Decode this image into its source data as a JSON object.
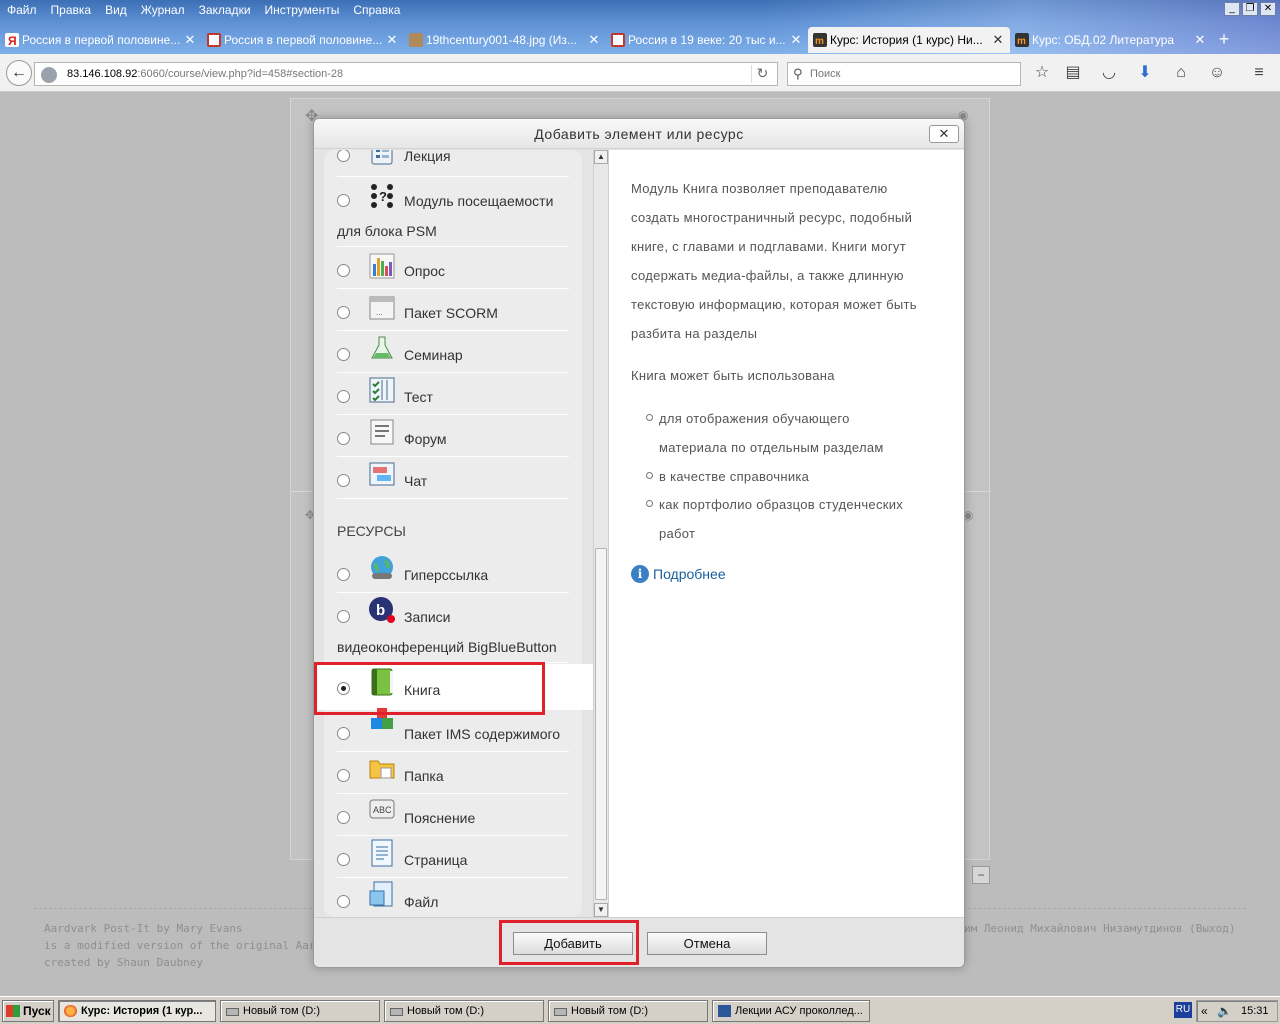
{
  "browser": {
    "menu": [
      "Файл",
      "Правка",
      "Вид",
      "Журнал",
      "Закладки",
      "Инструменты",
      "Справка"
    ],
    "tabs": [
      {
        "title": "Россия в первой половине...",
        "icon": "yandex-icon",
        "active": false
      },
      {
        "title": "Россия в первой половине...",
        "icon": "image-icon",
        "active": false
      },
      {
        "title": "19thcentury001-48.jpg (Из...",
        "icon": "jpg-icon",
        "active": false
      },
      {
        "title": "Россия в 19 веке: 20 тыс и...",
        "icon": "image-icon",
        "active": false
      },
      {
        "title": "Курс: История (1 курс) Ни...",
        "icon": "moodle-icon",
        "active": true
      },
      {
        "title": "Курс: ОБД.02 Литература",
        "icon": "moodle-icon",
        "active": false
      }
    ],
    "url_host": "83.146.108.92",
    "url_rest": ":6060/course/view.php?id=458#section-28",
    "search_placeholder": "Поиск"
  },
  "page": {
    "footer_left": [
      "Aardvark Post-It by Mary Evans",
      "is a modified version of the original Aardvark the",
      "created by Shaun Daubney"
    ],
    "footer_right": "им Леонид Михайлович Низамутдинов (Выход)"
  },
  "modal": {
    "title": "Добавить элемент или ресурс",
    "close_label": "✕",
    "activities": [
      {
        "label": "Лекция",
        "icon": "lesson-icon"
      },
      {
        "label": "Модуль посещаемости",
        "label2": "для блока PSM",
        "icon": "attendance-icon"
      },
      {
        "label": "Опрос",
        "icon": "choice-icon"
      },
      {
        "label": "Пакет SCORM",
        "icon": "scorm-icon"
      },
      {
        "label": "Семинар",
        "icon": "workshop-icon"
      },
      {
        "label": "Тест",
        "icon": "quiz-icon"
      },
      {
        "label": "Форум",
        "icon": "forum-icon"
      },
      {
        "label": "Чат",
        "icon": "chat-icon"
      }
    ],
    "resources_heading": "РЕСУРСЫ",
    "resources": [
      {
        "label": "Гиперссылка",
        "icon": "url-icon"
      },
      {
        "label": "Записи",
        "label2": "видеоконференций BigBlueButton",
        "icon": "bigbluebutton-icon"
      },
      {
        "label": "Книга",
        "icon": "book-icon",
        "selected": true
      },
      {
        "label": "Пакет IMS содержимого",
        "icon": "imscp-icon"
      },
      {
        "label": "Папка",
        "icon": "folder-icon"
      },
      {
        "label": "Пояснение",
        "icon": "label-icon"
      },
      {
        "label": "Страница",
        "icon": "page-icon"
      },
      {
        "label": "Файл",
        "icon": "file-icon"
      }
    ],
    "description": {
      "lines1": [
        "Модуль Книга позволяет преподавателю",
        "создать многостраничный ресурс, подобный",
        "книге, с главами и подглавами. Книги могут",
        "содержать медиа-файлы, а также длинную",
        "текстовую информацию, которая может быть",
        "разбита на разделы"
      ],
      "para2": "Книга может быть использована",
      "bullets": [
        [
          "для отображения обучающего",
          "материала по отдельным разделам"
        ],
        [
          "в качестве справочника"
        ],
        [
          "как портфолио образцов студенческих",
          "работ"
        ]
      ],
      "more_link": "Подробнее"
    },
    "add_button": "Добавить",
    "cancel_button": "Отмена"
  },
  "taskbar": {
    "start": "Пуск",
    "tasks": [
      {
        "label": "Курс: История (1 кур...",
        "active": true
      },
      {
        "label": "Новый том (D:)",
        "active": false
      },
      {
        "label": "Новый том (D:)",
        "active": false
      },
      {
        "label": "Новый том (D:)",
        "active": false
      },
      {
        "label": "Лекции АСУ проколлед...",
        "active": false
      }
    ],
    "lang": "RU",
    "clock": "15:31"
  },
  "colors": {
    "highlight": "#e0202a",
    "link": "#1a5f9e",
    "title_bar": "#4a7fc4"
  }
}
